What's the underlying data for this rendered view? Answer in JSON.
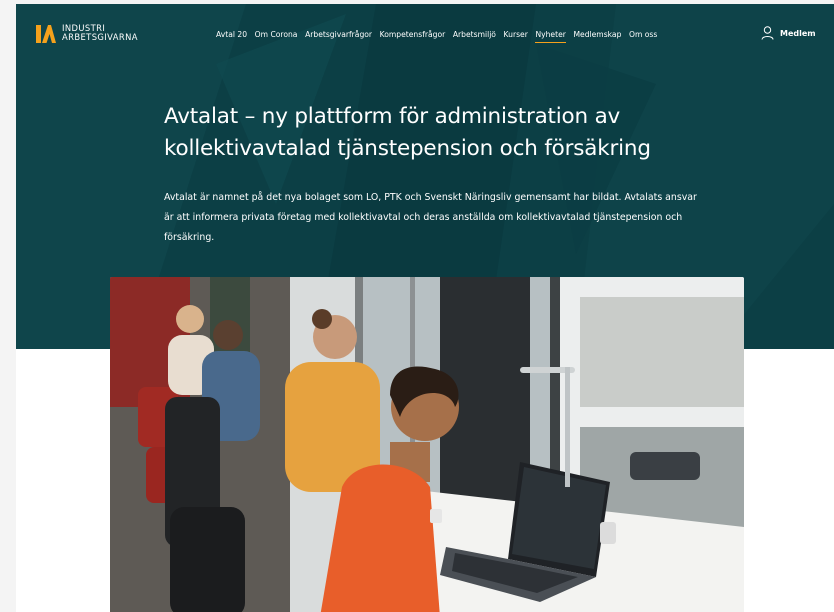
{
  "brand": {
    "line1": "INDUSTRI",
    "line2": "ARBETSGIVARNA",
    "accent": "#f5a11c"
  },
  "nav": {
    "items": [
      {
        "label": "Avtal 20",
        "active": false
      },
      {
        "label": "Om Corona",
        "active": false
      },
      {
        "label": "Arbetsgivarfrågor",
        "active": false
      },
      {
        "label": "Kompetensfrågor",
        "active": false
      },
      {
        "label": "Arbetsmiljö",
        "active": false
      },
      {
        "label": "Kurser",
        "active": false
      },
      {
        "label": "Nyheter",
        "active": true
      },
      {
        "label": "Medlemskap",
        "active": false
      },
      {
        "label": "Om oss",
        "active": false
      }
    ],
    "member_label": "Medlem"
  },
  "article": {
    "title": "Avtalat – ny plattform för administration av kollektivavtalad tjänstepension och försäkring",
    "lead": "Avtalat är namnet på det nya bolaget som LO, PTK och Svenskt Näringsliv gemensamt har bildat. Avtalats ansvar är att informera privata företag med kollektivavtal och deras anställda om kollektivavtalad tjänstepension och försäkring."
  },
  "colors": {
    "hero_bg": "#0c3f45",
    "text_on_dark": "#ffffff"
  }
}
